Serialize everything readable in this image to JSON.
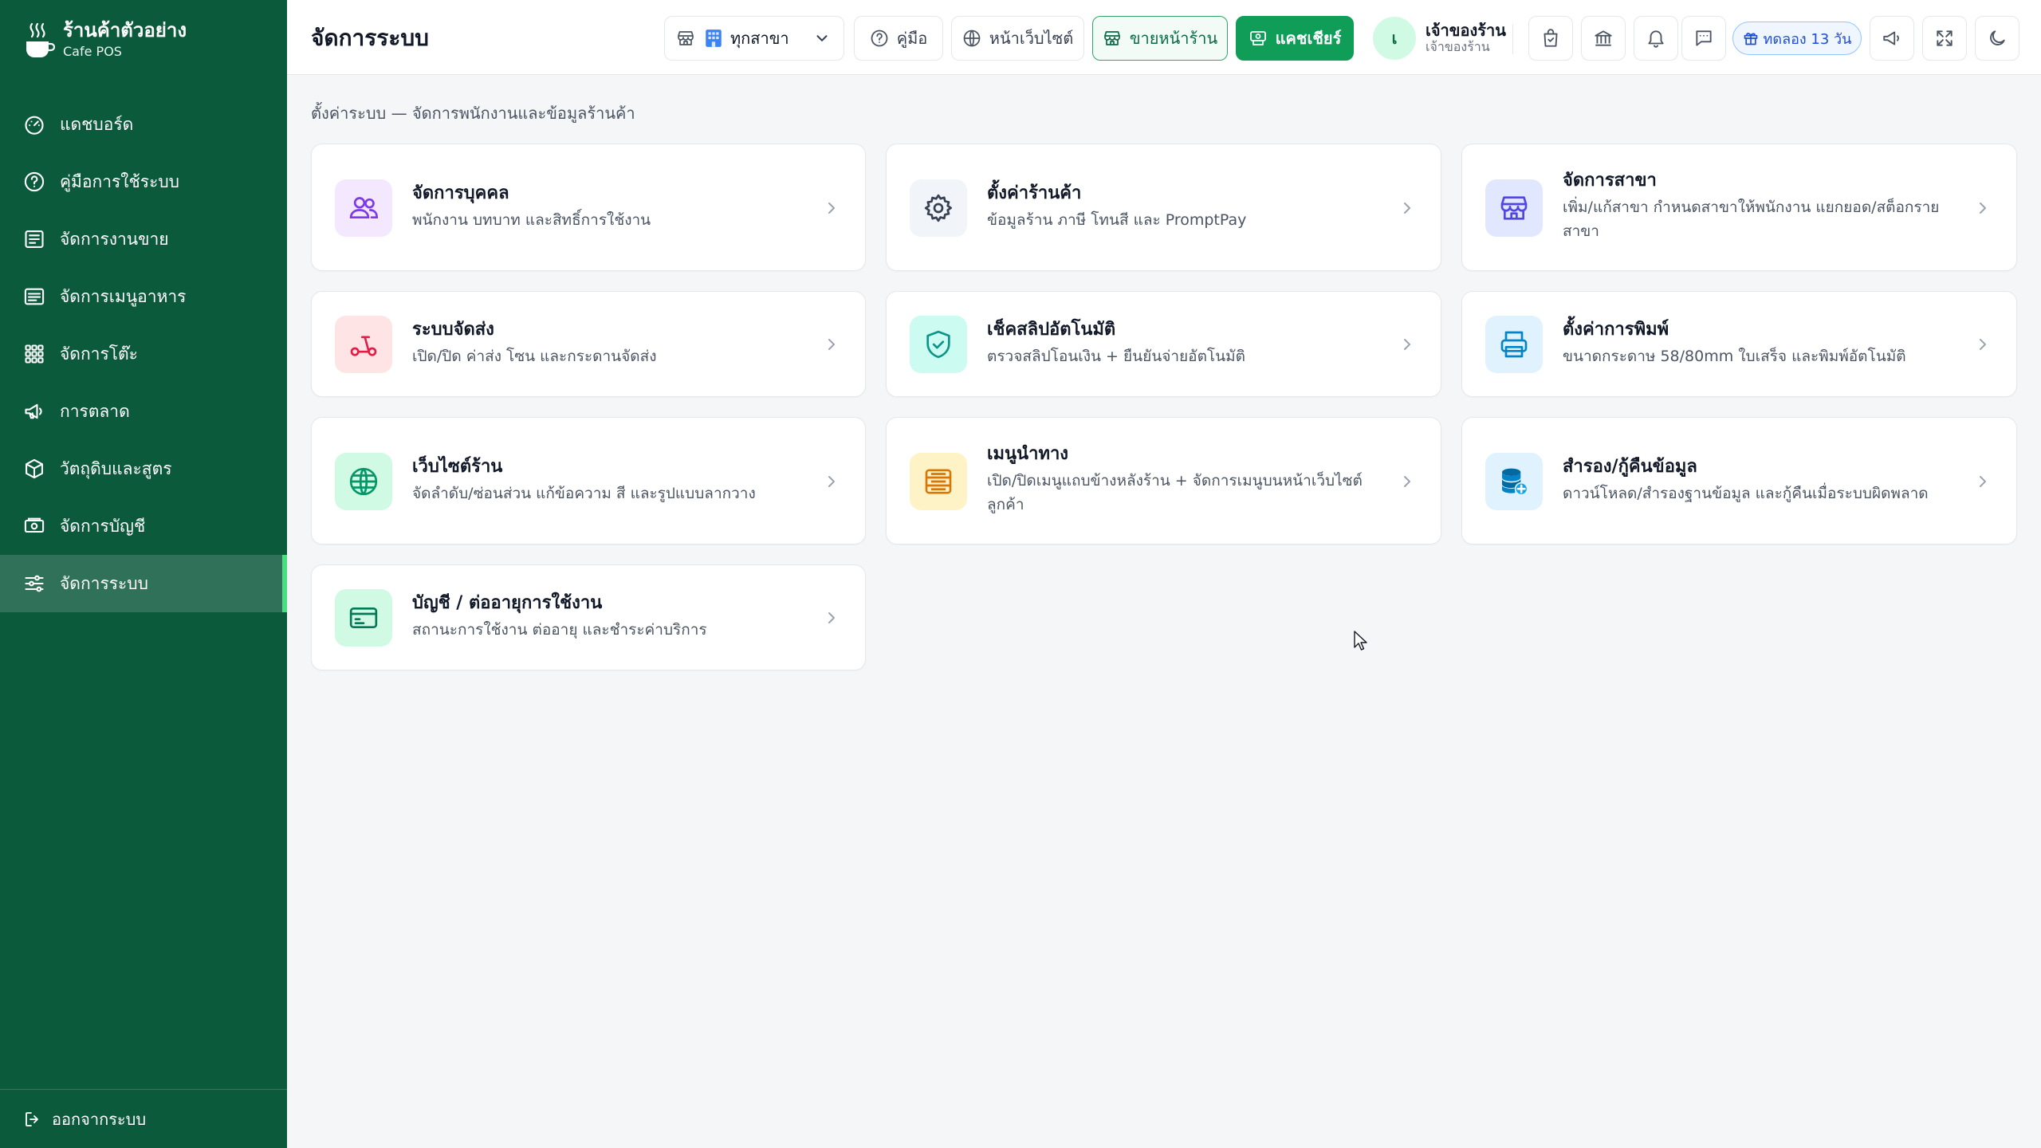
{
  "brand": {
    "name": "ร้านค้าตัวอย่าง",
    "subtitle": "Cafe POS",
    "icon": "coffee-cup-icon"
  },
  "sidebar": {
    "items": [
      {
        "label": "แดชบอร์ด",
        "icon": "dashboard-gauge-icon",
        "active": false
      },
      {
        "label": "คู่มือการใช้ระบบ",
        "icon": "help-circle-icon",
        "active": false
      },
      {
        "label": "จัดการงานขาย",
        "icon": "sales-list-icon",
        "active": false
      },
      {
        "label": "จัดการเมนูอาหาร",
        "icon": "menu-list-icon",
        "active": false
      },
      {
        "label": "จัดการโต๊ะ",
        "icon": "table-grid-icon",
        "active": false
      },
      {
        "label": "การตลาด",
        "icon": "megaphone-icon",
        "active": false
      },
      {
        "label": "วัตถุดิบและสูตร",
        "icon": "box-icon",
        "active": false
      },
      {
        "label": "จัดการบัญชี",
        "icon": "banknote-icon",
        "active": false
      },
      {
        "label": "จัดการระบบ",
        "icon": "sliders-icon",
        "active": true
      }
    ],
    "logout_label": "ออกจากระบบ"
  },
  "header": {
    "title": "จัดการระบบ",
    "branch_selector": {
      "value": "ทุกสาขา"
    },
    "guide_label": "คู่มือ",
    "website_label": "หน้าเว็บไซต์",
    "storefront_label": "ขายหน้าร้าน",
    "cashier_label": "แคชเชียร์",
    "user": {
      "initial": "เ",
      "name": "เจ้าของร้าน",
      "role": "เจ้าของร้าน"
    },
    "trial_label": "ทดลอง 13 วัน"
  },
  "breadcrumb": "ตั้งค่าระบบ — จัดการพนักงานและข้อมูลร้านค้า",
  "cards": [
    {
      "title": "จัดการบุคคล",
      "desc": "พนักงาน บทบาท และสิทธิ์การใช้งาน",
      "icon": "users-icon",
      "color": "#7c3aed",
      "bg": "#f3e8ff"
    },
    {
      "title": "ตั้งค่าร้านค้า",
      "desc": "ข้อมูลร้าน ภาษี โทนสี และ PromptPay",
      "icon": "gear-icon",
      "color": "#374151",
      "bg": "#f1f5f9"
    },
    {
      "title": "จัดการสาขา",
      "desc": "เพิ่ม/แก้สาขา กำหนดสาขาให้พนักงาน แยกยอด/สต็อกราย สาขา",
      "icon": "store-icon",
      "color": "#4f46e5",
      "bg": "#e0e7ff"
    },
    {
      "title": "ระบบจัดส่ง",
      "desc": "เปิด/ปิด ค่าส่ง โซน และกระดานจัดส่ง",
      "icon": "scooter-icon",
      "color": "#e11d48",
      "bg": "#ffe4e6"
    },
    {
      "title": "เช็คสลิปอัตโนมัติ",
      "desc": "ตรวจสลิปโอนเงิน + ยืนยันจ่ายอัตโนมัติ",
      "icon": "shield-check-icon",
      "color": "#0d9488",
      "bg": "#ccfbf1"
    },
    {
      "title": "ตั้งค่าการพิมพ์",
      "desc": "ขนาดกระดาษ 58/80mm ใบเสร็จ และพิมพ์อัตโนมัติ",
      "icon": "printer-icon",
      "color": "#0284c7",
      "bg": "#e0f2fe"
    },
    {
      "title": "เว็บไซต์ร้าน",
      "desc": "จัดลำดับ/ซ่อนส่วน แก้ข้อความ สี และรูปแบบลากวาง",
      "icon": "globe-icon",
      "color": "#059669",
      "bg": "#d1fae5"
    },
    {
      "title": "เมนูนำทาง",
      "desc": "เปิด/ปิดเมนูแถบข้างหลังร้าน + จัดการเมนูบนหน้าเว็บไซต์ ลูกค้า",
      "icon": "menu-panel-icon",
      "color": "#d97706",
      "bg": "#fef3c7"
    },
    {
      "title": "สำรอง/กู้คืนข้อมูล",
      "desc": "ดาวน์โหลด/สำรองฐานข้อมูล และกู้คืนเมื่อระบบผิดพลาด",
      "icon": "database-icon",
      "color": "#0369a1",
      "bg": "#e0f2fe"
    },
    {
      "title": "บัญชี / ต่ออายุการใช้งาน",
      "desc": "สถานะการใช้งาน ต่ออายุ และชำระค่าบริการ",
      "icon": "credit-card-icon",
      "color": "#047857",
      "bg": "#d1fae5"
    }
  ]
}
